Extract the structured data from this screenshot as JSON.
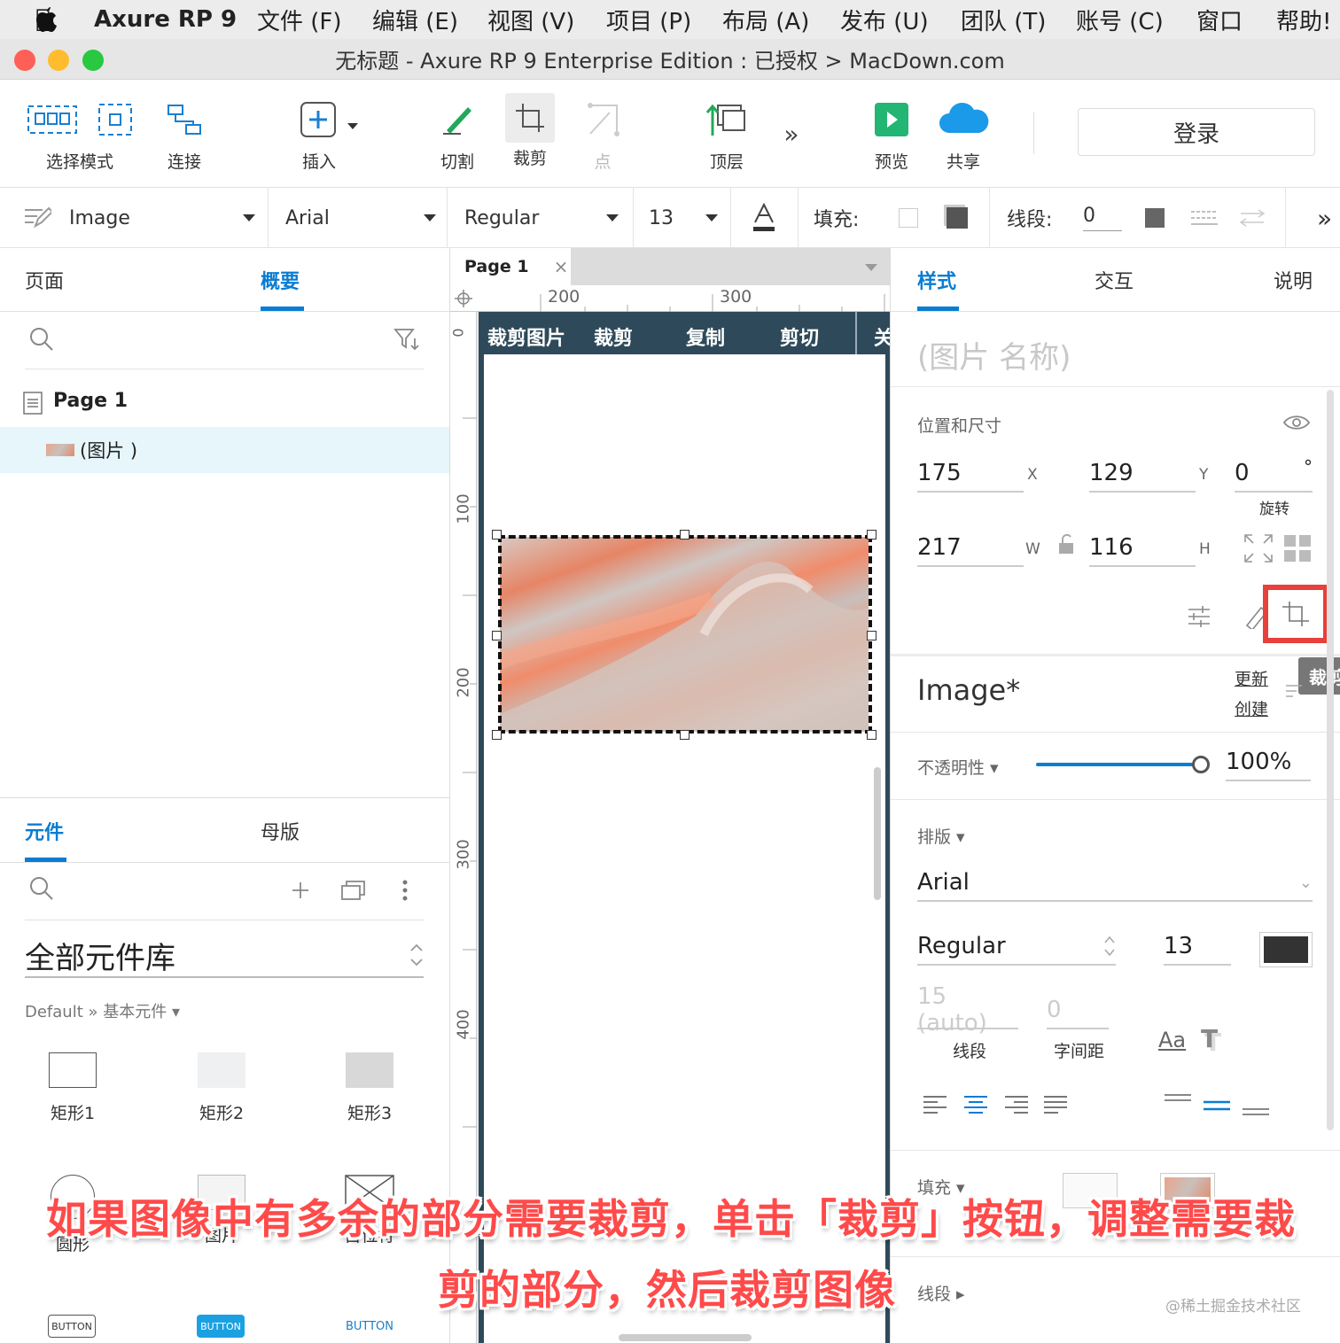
{
  "menubar": {
    "app_name": "Axure RP 9",
    "items": [
      "文件 (F)",
      "编辑 (E)",
      "视图 (V)",
      "项目 (P)",
      "布局 (A)",
      "发布 (U)",
      "团队 (T)",
      "账号 (C)",
      "窗口",
      "帮助!"
    ]
  },
  "window": {
    "title": "无标题 - Axure RP 9 Enterprise Edition : 已授权 > MacDown.com",
    "colors": {
      "close": "#fe5f57",
      "minimize": "#febc2e",
      "zoom": "#28c840"
    }
  },
  "toolbar": {
    "select_mode": "选择模式",
    "connect": "连接",
    "insert": "插入",
    "slice": "切割",
    "crop": "裁剪",
    "point": "点",
    "top_layer": "顶层",
    "more": "»",
    "preview": "预览",
    "share": "共享",
    "login": "登录"
  },
  "format_bar": {
    "style_name": "Image",
    "font_family": "Arial",
    "font_weight": "Regular",
    "font_size": "13",
    "fill_label": "填充:",
    "stroke_label": "线段:",
    "stroke_value": "0",
    "more": "»"
  },
  "left_panel": {
    "tabs": [
      "页面",
      "概要"
    ],
    "active_tab": "概要",
    "page_name": "Page 1",
    "outline_item": "(图片 )",
    "lib_tabs": [
      "元件",
      "母版"
    ],
    "lib_active": "元件",
    "library_name": "全部元件库",
    "breadcrumb": "Default » 基本元件 ▾",
    "widgets": [
      "矩形1",
      "矩形2",
      "矩形3",
      "圆形",
      "图片",
      "占位符"
    ],
    "buttons": [
      "BUTTON",
      "BUTTON",
      "BUTTON"
    ]
  },
  "canvas": {
    "tab_name": "Page 1",
    "ruler_h": [
      "200",
      "300"
    ],
    "ruler_v": [
      "0",
      "100",
      "200",
      "300",
      "400"
    ],
    "crop_toolbar": [
      "裁剪图片",
      "裁剪",
      "复制",
      "剪切",
      "关"
    ]
  },
  "right_panel": {
    "tabs": [
      "样式",
      "交互",
      "说明"
    ],
    "active_tab": "样式",
    "name_placeholder": "(图片 名称)",
    "section_position": "位置和尺寸",
    "x_value": "175",
    "x_label": "X",
    "y_value": "129",
    "y_label": "Y",
    "rotation_value": "0",
    "rotation_unit": "°",
    "rotation_label": "旋转",
    "w_value": "217",
    "w_label": "W",
    "h_value": "116",
    "h_label": "H",
    "crop_tooltip": "裁剪",
    "style_name": "Image*",
    "update_link": "更新",
    "create_link": "创建",
    "opacity_label": "不透明性 ▾",
    "opacity_value": "100%",
    "opacity": 1.0,
    "typography_label": "排版 ▾",
    "font_family": "Arial",
    "font_weight": "Regular",
    "font_size": "13",
    "line_spacing_value": "15 (auto)",
    "line_spacing_label": "线段",
    "char_spacing_value": "0",
    "char_spacing_label": "字间距",
    "aa_label": "Aa",
    "fill_label": "填充 ▾",
    "stroke_label": "线段 ▸",
    "accent_color": "#0a7cd2",
    "highlight_color": "#e8403a"
  },
  "caption": {
    "line1": "如果图像中有多余的部分需要裁剪，单击「裁剪」按钮，调整需要裁",
    "line2": "剪的部分，然后裁剪图像"
  },
  "watermark": "@稀土掘金技术社区"
}
